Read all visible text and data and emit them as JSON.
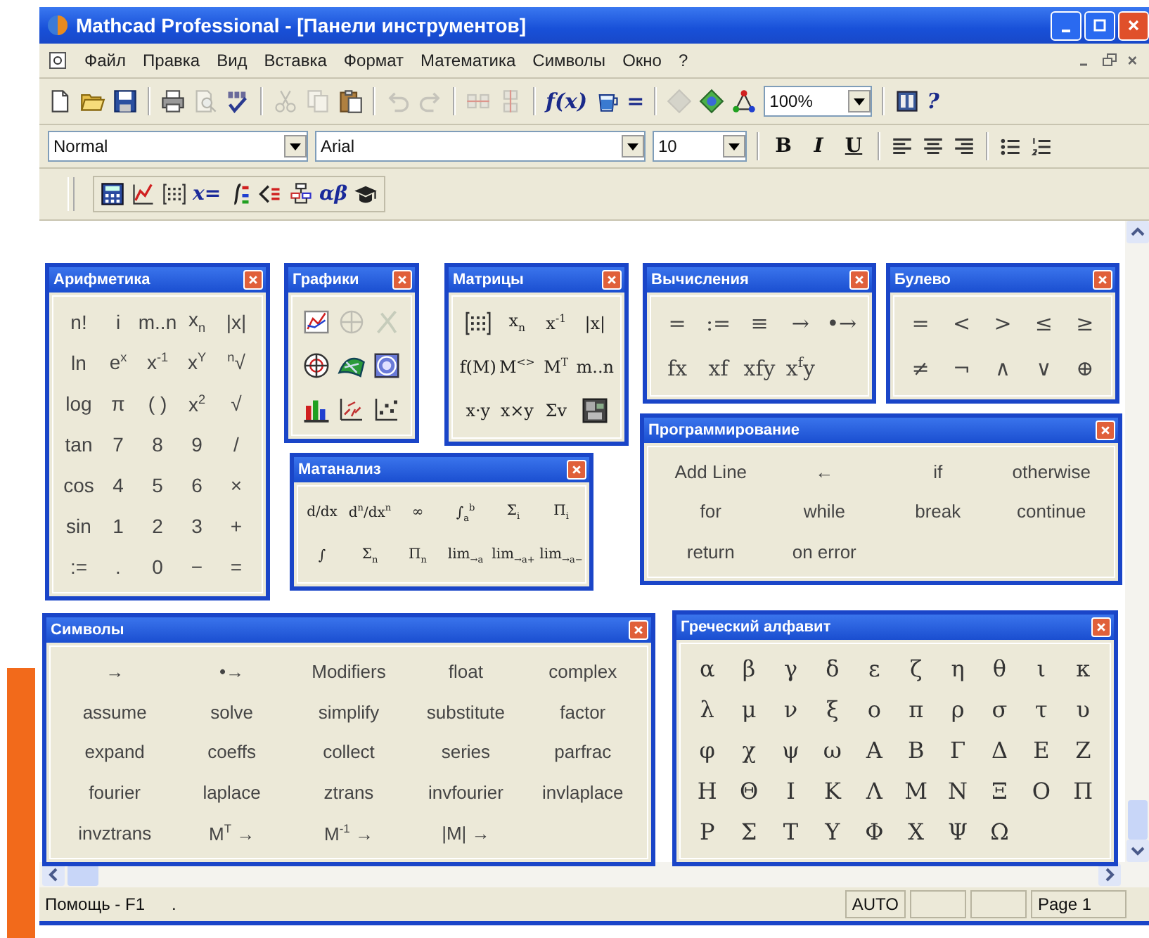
{
  "window": {
    "title": "Mathcad Professional - [Панели инструментов]"
  },
  "menu": [
    "Файл",
    "Правка",
    "Вид",
    "Вставка",
    "Формат",
    "Математика",
    "Символы",
    "Окно",
    "?"
  ],
  "standard_toolbar": [
    {
      "kind": "new",
      "disabled": false
    },
    {
      "kind": "open",
      "disabled": false
    },
    {
      "kind": "save",
      "disabled": false
    },
    {
      "kind": "separator"
    },
    {
      "kind": "print",
      "disabled": false
    },
    {
      "kind": "preview",
      "disabled": true
    },
    {
      "kind": "spell",
      "disabled": false
    },
    {
      "kind": "separator"
    },
    {
      "kind": "cut",
      "disabled": true
    },
    {
      "kind": "copy",
      "disabled": true
    },
    {
      "kind": "paste",
      "disabled": false
    },
    {
      "kind": "separator"
    },
    {
      "kind": "undo",
      "disabled": true
    },
    {
      "kind": "redo",
      "disabled": true
    },
    {
      "kind": "separator"
    },
    {
      "kind": "across",
      "disabled": true
    },
    {
      "kind": "down",
      "disabled": true
    },
    {
      "kind": "separator"
    },
    {
      "kind": "text",
      "label": "f(x)",
      "disabled": false
    },
    {
      "kind": "units",
      "disabled": false
    },
    {
      "kind": "text",
      "label": "=",
      "disabled": false
    },
    {
      "kind": "separator"
    },
    {
      "kind": "component",
      "disabled": true
    },
    {
      "kind": "wizard",
      "disabled": false
    },
    {
      "kind": "resource",
      "disabled": false
    },
    {
      "kind": "zoom",
      "value": "100%"
    },
    {
      "kind": "separator"
    },
    {
      "kind": "book",
      "disabled": false
    },
    {
      "kind": "text",
      "label": "?",
      "disabled": false
    }
  ],
  "format_toolbar": {
    "style": "Normal",
    "font": "Arial",
    "size": "10",
    "buttons": [
      "B",
      "I",
      "U"
    ]
  },
  "math_toolbar": [
    {
      "kind": "calculator"
    },
    {
      "kind": "graph"
    },
    {
      "kind": "matrix"
    },
    {
      "kind": "text",
      "label": "x="
    },
    {
      "kind": "calculus"
    },
    {
      "kind": "boolean"
    },
    {
      "kind": "programming"
    },
    {
      "kind": "text",
      "label": "αβ"
    },
    {
      "kind": "symbolic"
    }
  ],
  "palettes": [
    {
      "title": "Арифметика",
      "rows": [
        [
          "n!",
          "i",
          "m..n",
          "x$_{n}$",
          "|x|"
        ],
        [
          "ln",
          "e$^{x}$",
          "x$^{-1}$",
          "x$^{Y}$",
          "$^{n}$√"
        ],
        [
          "log",
          "π",
          "( )",
          "x$^{2}$",
          "√"
        ],
        [
          "tan",
          "7",
          "8",
          "9",
          "/"
        ],
        [
          "cos",
          "4",
          "5",
          "6",
          "×"
        ],
        [
          "sin",
          "1",
          "2",
          "3",
          "+"
        ],
        [
          ":=",
          ".",
          "0",
          "−",
          "="
        ]
      ]
    },
    {
      "title": "Графики",
      "rows": [
        [
          {
            "kind": "xy",
            "disabled": false
          },
          {
            "kind": "polar",
            "disabled": true
          },
          {
            "kind": "trace",
            "disabled": true
          }
        ],
        [
          {
            "kind": "target",
            "disabled": false
          },
          {
            "kind": "surface",
            "disabled": false
          },
          {
            "kind": "contour",
            "disabled": false
          }
        ],
        [
          {
            "kind": "bars3d",
            "disabled": false
          },
          {
            "kind": "vector",
            "disabled": false
          },
          {
            "kind": "scatter",
            "disabled": false
          }
        ]
      ]
    },
    {
      "title": "Матрицы",
      "rows": [
        [
          {
            "kind": "matrix",
            "disabled": false
          },
          "x$_{n}$",
          "x$^{-1}$",
          "|x|"
        ],
        [
          "f(M)",
          "M$^{<>}$",
          "M$^{T}$",
          "m..n"
        ],
        [
          "x·y",
          "x×y",
          "Σv",
          {
            "kind": "picture",
            "disabled": false
          }
        ]
      ]
    },
    {
      "title": "Вычисления",
      "rows": [
        [
          "=",
          ":=",
          "≡",
          "→",
          "•→"
        ],
        [
          "fx",
          "xf",
          "xfy",
          "x$^{f}$y"
        ]
      ]
    },
    {
      "title": "Булево",
      "rows": [
        [
          "=",
          "<",
          ">",
          "≤",
          "≥"
        ],
        [
          "≠",
          "¬",
          "∧",
          "∨",
          "⊕"
        ]
      ]
    },
    {
      "title": "Матанализ",
      "rows": [
        [
          "d/dx",
          "d$^{n}$/dx$^{n}$",
          "∞",
          "∫$_{a}$$^{b}$",
          "Σ$_{i}$",
          "Π$_{i}$"
        ],
        [
          "∫",
          "Σ$_{n}$",
          "Π$_{n}$",
          "lim$_{→a}$",
          "lim$_{→a+}$",
          "lim$_{→a−}$"
        ]
      ]
    },
    {
      "title": "Программирование",
      "rows": [
        [
          "Add Line",
          "←",
          "if",
          "otherwise"
        ],
        [
          "for",
          "while",
          "break",
          "continue"
        ],
        [
          "return",
          "on error"
        ]
      ]
    },
    {
      "title": "Символы",
      "rows": [
        [
          "→",
          "•→",
          "Modifiers",
          "float",
          "complex"
        ],
        [
          "assume",
          "solve",
          "simplify",
          "substitute",
          "factor"
        ],
        [
          "expand",
          "coeffs",
          "collect",
          "series",
          "parfrac"
        ],
        [
          "fourier",
          "laplace",
          "ztrans",
          "invfourier",
          "invlaplace"
        ],
        [
          "invztrans",
          "M$^{T}$ →",
          "M$^{-1}$ →",
          "|M| →"
        ]
      ]
    },
    {
      "title": "Греческий алфавит",
      "rows": [
        [
          "α",
          "β",
          "γ",
          "δ",
          "ε",
          "ζ",
          "η",
          "θ",
          "ι",
          "κ"
        ],
        [
          "λ",
          "μ",
          "ν",
          "ξ",
          "ο",
          "π",
          "ρ",
          "σ",
          "τ",
          "υ"
        ],
        [
          "φ",
          "χ",
          "ψ",
          "ω",
          "Α",
          "Β",
          "Γ",
          "Δ",
          "Ε",
          "Ζ"
        ],
        [
          "Η",
          "Θ",
          "Ι",
          "Κ",
          "Λ",
          "Μ",
          "Ν",
          "Ξ",
          "Ο",
          "Π"
        ],
        [
          "Ρ",
          "Σ",
          "Τ",
          "Υ",
          "Φ",
          "Χ",
          "Ψ",
          "Ω"
        ]
      ]
    }
  ],
  "status_bar": {
    "help": "Помощь - F1",
    "note": ".",
    "mode": "AUTO",
    "page": "Page 1"
  }
}
